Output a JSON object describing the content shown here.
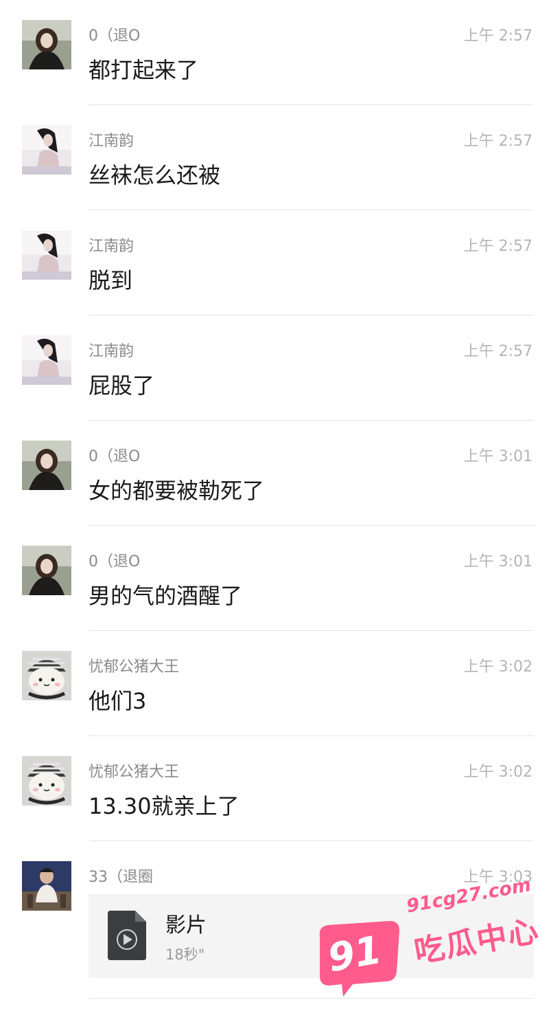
{
  "messages": [
    {
      "sender": "0（退O",
      "time": "上午 2:57",
      "text": "都打起来了",
      "avatar": "photo-girl-icon"
    },
    {
      "sender": "江南韵",
      "time": "上午 2:57",
      "text": "丝袜怎么还被",
      "avatar": "photo-woman-icon"
    },
    {
      "sender": "江南韵",
      "time": "上午 2:57",
      "text": "脱到",
      "avatar": "photo-woman-icon"
    },
    {
      "sender": "江南韵",
      "time": "上午 2:57",
      "text": "屁股了",
      "avatar": "photo-woman-icon"
    },
    {
      "sender": "0（退O",
      "time": "上午 3:01",
      "text": "女的都要被勒死了",
      "avatar": "photo-girl-icon"
    },
    {
      "sender": "0（退O",
      "time": "上午 3:01",
      "text": "男的气的酒醒了",
      "avatar": "photo-girl-icon"
    },
    {
      "sender": "忧郁公猪大王",
      "time": "上午 3:02",
      "text": "他们3",
      "avatar": "plush-toy-icon"
    },
    {
      "sender": "忧郁公猪大王",
      "time": "上午 3:02",
      "text": "13.30就亲上了",
      "avatar": "plush-toy-icon"
    }
  ],
  "file_message": {
    "sender": "33（退圈",
    "time": "上午 3:03",
    "title": "影片",
    "duration": "18秒\"",
    "icon": "video-file-icon"
  },
  "watermark": {
    "number": "91",
    "url": "91cg27.com",
    "name": "吃瓜中心",
    "color": "#ff5b8d"
  }
}
